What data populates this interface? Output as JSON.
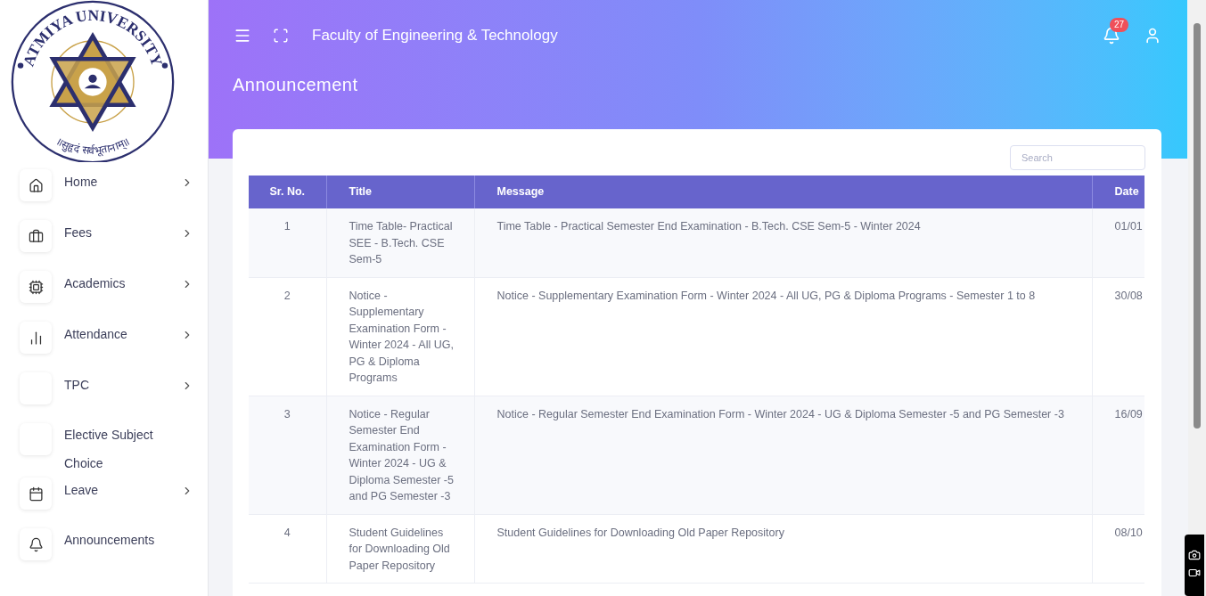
{
  "logo": {
    "name": "ATMIYA UNIVERSITY",
    "motto": "॥सुहृदं सर्वभूतानाम्॥"
  },
  "sidebar": {
    "items": [
      {
        "label": "Home",
        "has_submenu": true
      },
      {
        "label": "Fees",
        "has_submenu": true
      },
      {
        "label": "Academics",
        "has_submenu": true
      },
      {
        "label": "Attendance",
        "has_submenu": true
      },
      {
        "label": "TPC",
        "has_submenu": true
      },
      {
        "label": "Elective Subject Choice",
        "has_submenu": false
      },
      {
        "label": "Leave",
        "has_submenu": true
      },
      {
        "label": "Announcements",
        "has_submenu": false
      }
    ]
  },
  "header": {
    "title": "Faculty of Engineering & Technology",
    "notification_count": "27"
  },
  "page_title": "Announcement",
  "search": {
    "placeholder": "Search"
  },
  "table": {
    "columns": [
      "Sr. No.",
      "Title",
      "Message",
      "Date"
    ],
    "rows": [
      {
        "sr": "1",
        "title": "Time Table- Practical SEE - B.Tech. CSE Sem-5",
        "message": "Time Table - Practical Semester End Examination - B.Tech. CSE Sem-5 - Winter 2024",
        "date": "01/01"
      },
      {
        "sr": "2",
        "title": "Notice - Supplementary Examination Form - Winter 2024 - All UG, PG & Diploma Programs",
        "message": "Notice - Supplementary Examination Form - Winter 2024 - All UG, PG & Diploma Programs - Semester 1 to 8",
        "date": "30/08"
      },
      {
        "sr": "3",
        "title": "Notice - Regular Semester End Examination Form - Winter 2024 - UG & Diploma Semester -5 and PG Semester -3",
        "message": "Notice - Regular Semester End Examination Form - Winter 2024 - UG & Diploma Semester -5 and PG Semester -3",
        "date": "16/09"
      },
      {
        "sr": "4",
        "title": "Student Guidelines for Downloading Old Paper Repository",
        "message": "Student Guidelines for Downloading Old Paper Repository",
        "date": "08/10"
      }
    ]
  }
}
